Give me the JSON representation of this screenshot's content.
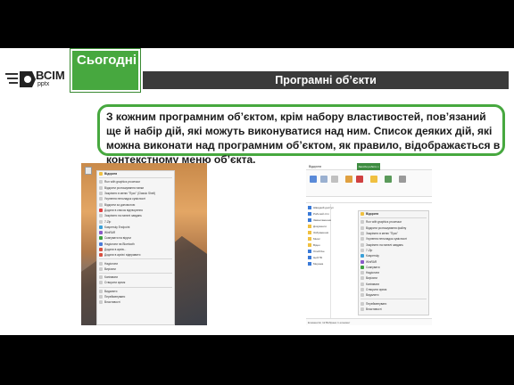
{
  "header": {
    "brand": "ВСІМ",
    "brand_sub": "pptx",
    "today_label": "Сьогодні",
    "title": "Програмні об’єкти"
  },
  "body_text": "З кожним програмним об’єктом, крім набору властивостей, пов’язаний ще й набір дій, які можуть виконуватися над ним. Список деяких дій, які можна виконати над програмним об’єктом, як правило, відображається в контекстному меню об’єкта.",
  "screenshot1": {
    "menu_items": [
      {
        "label": "Відкрити",
        "color": "#f0c040"
      },
      {
        "label": "Run with graphics processor",
        "color": "#cccccc"
      },
      {
        "label": "Відкрити розташування папки",
        "color": "#cccccc"
      },
      {
        "label": "Закріпити в меню \"Пуск\" (Classic Shell)",
        "color": "#cccccc"
      },
      {
        "label": "Усунення неполадок сумісності",
        "color": "#cccccc"
      },
      {
        "label": "Відкрити за допомогою",
        "color": "#cccccc"
      },
      {
        "label": "Додати в список відтворення",
        "color": "#e04040"
      },
      {
        "label": "Закріпити на панелі завдань",
        "color": "#cccccc"
      },
      {
        "label": "7-Zip",
        "color": "#cccccc"
      },
      {
        "label": "Kaspersky Endpoint",
        "color": "#3aa0d8"
      },
      {
        "label": "WinRAR",
        "color": "#8a5ac8"
      },
      {
        "label": "Сканувати на віруси",
        "color": "#40a040"
      },
      {
        "label": "Надіслати на Bluetooth",
        "color": "#4a7ad8"
      },
      {
        "label": "Додати в архів...",
        "color": "#d85040"
      },
      {
        "label": "Додати в архів і відправити",
        "color": "#d85040"
      },
      {
        "label": "Надіслати",
        "color": "#cccccc"
      },
      {
        "label": "Вирізати",
        "color": "#cccccc"
      },
      {
        "label": "Копіювати",
        "color": "#cccccc"
      },
      {
        "label": "Створити ярлик",
        "color": "#cccccc"
      },
      {
        "label": "Видалити",
        "color": "#cccccc"
      },
      {
        "label": "Перейменувати",
        "color": "#cccccc"
      },
      {
        "label": "Властивості",
        "color": "#cccccc"
      }
    ]
  },
  "screenshot2": {
    "window_title": "Відкрити",
    "ribbon_tab": "Засоби роботи з додатками",
    "nav_items": [
      {
        "label": "Швидкий доступ",
        "color": "#3a7ad8"
      },
      {
        "label": "Робочий стіл",
        "color": "#3a7ad8"
      },
      {
        "label": "Завантаження",
        "color": "#3a7ad8"
      },
      {
        "label": "Документи",
        "color": "#f0c040"
      },
      {
        "label": "Зображення",
        "color": "#f0c040"
      },
      {
        "label": "Music",
        "color": "#f0c040"
      },
      {
        "label": "Відео",
        "color": "#f0c040"
      },
      {
        "label": "OneDrive",
        "color": "#3a7ad8"
      },
      {
        "label": "Цей ПК",
        "color": "#3a7ad8"
      },
      {
        "label": "Мережа",
        "color": "#3a7ad8"
      }
    ],
    "menu_items": [
      {
        "label": "Відкрити",
        "color": "#f0c040"
      },
      {
        "label": "Run with graphics processor",
        "color": "#cccccc"
      },
      {
        "label": "Відкрити розташування файлу",
        "color": "#cccccc"
      },
      {
        "label": "Закріпити в меню \"Пуск\"",
        "color": "#cccccc"
      },
      {
        "label": "Усунення неполадок сумісності",
        "color": "#cccccc"
      },
      {
        "label": "Закріпити на панелі завдань",
        "color": "#cccccc"
      },
      {
        "label": "7-Zip",
        "color": "#cccccc"
      },
      {
        "label": "Kaspersky",
        "color": "#3aa0d8"
      },
      {
        "label": "WinRAR",
        "color": "#8a5ac8"
      },
      {
        "label": "Сканувати",
        "color": "#40a040"
      },
      {
        "label": "Надіслати",
        "color": "#cccccc"
      },
      {
        "label": "Вирізати",
        "color": "#cccccc"
      },
      {
        "label": "Копіювати",
        "color": "#cccccc"
      },
      {
        "label": "Створити ярлик",
        "color": "#cccccc"
      },
      {
        "label": "Видалити",
        "color": "#cccccc"
      },
      {
        "label": "Перейменувати",
        "color": "#cccccc"
      },
      {
        "label": "Властивості",
        "color": "#cccccc"
      }
    ],
    "status": "Елементів: 12   Вибрано 1 елемент"
  },
  "colors": {
    "accent_green": "#47a83f",
    "title_bar": "#3a3a3a"
  }
}
